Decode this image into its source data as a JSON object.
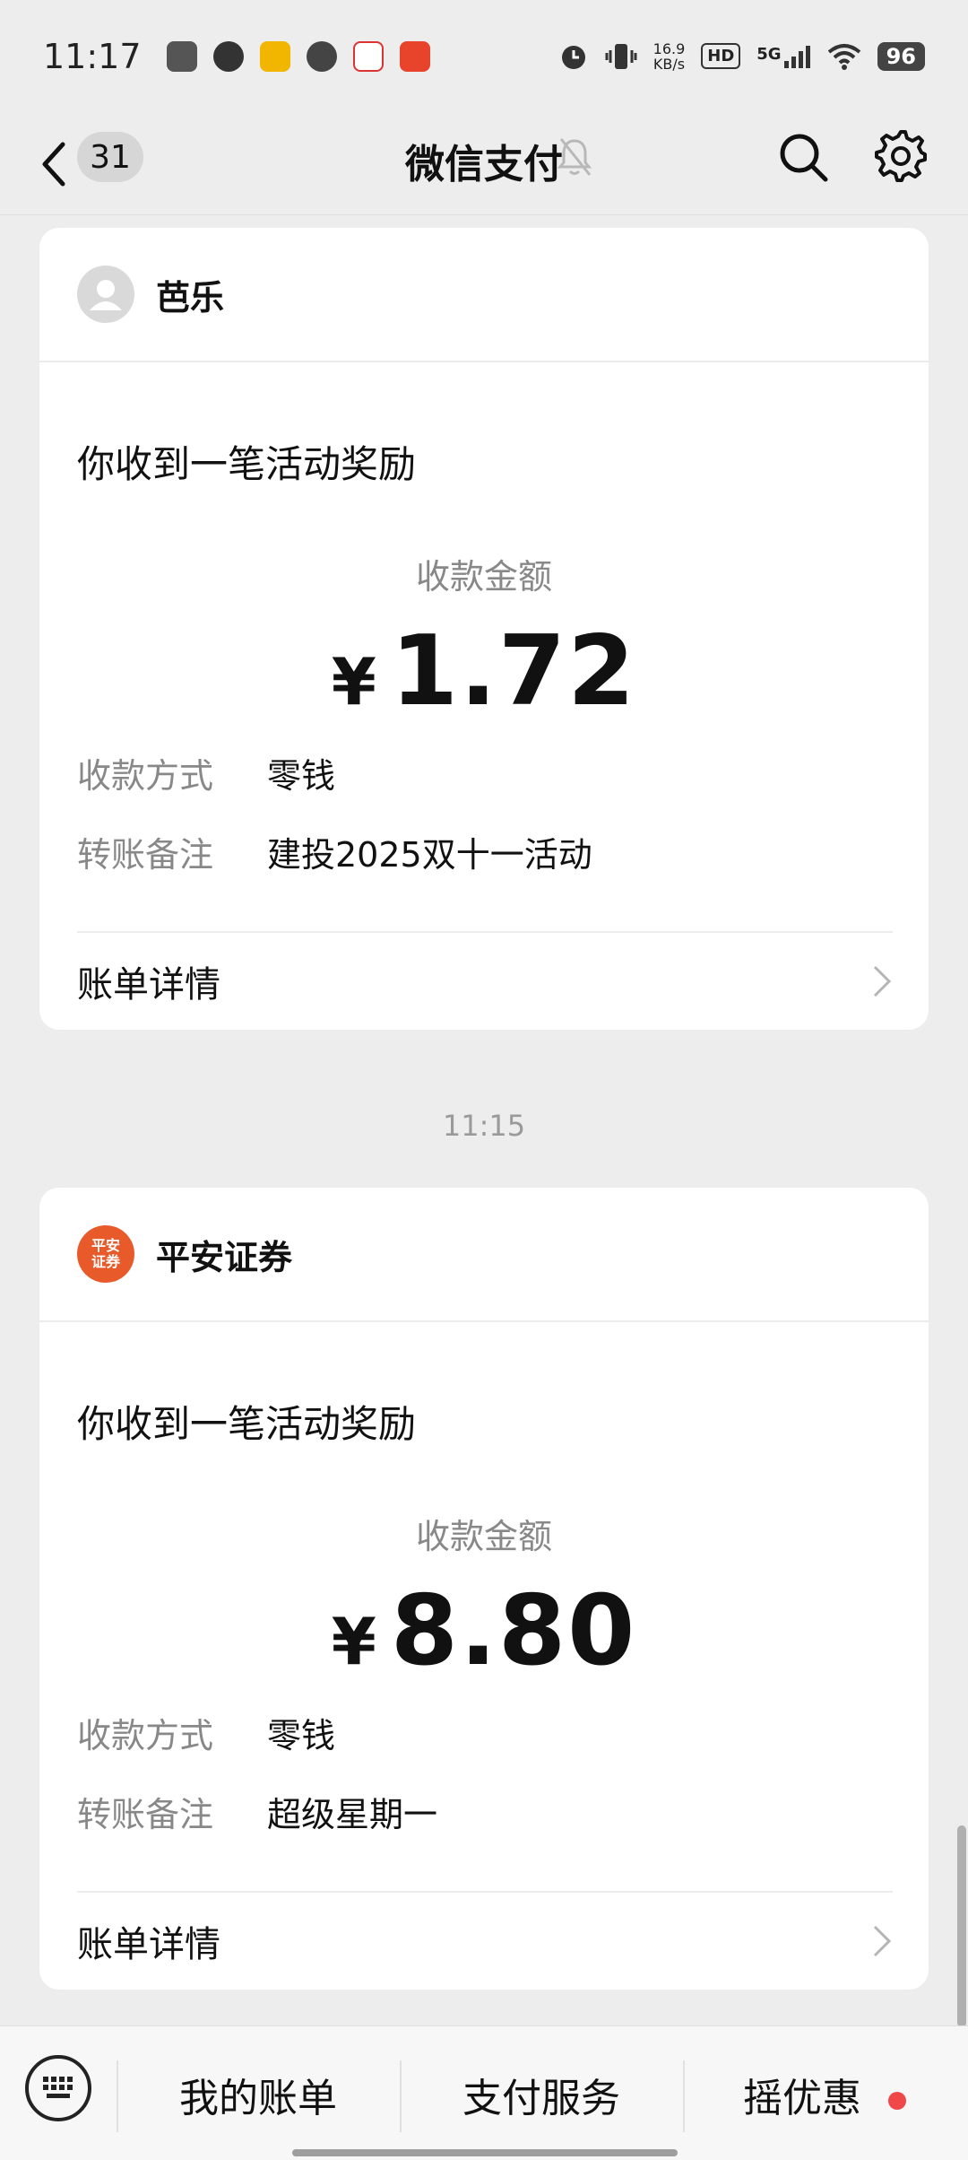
{
  "status_bar": {
    "time": "11:17",
    "net_speed_value": "16.9",
    "net_speed_unit": "KB/s",
    "hd": "HD",
    "signal": "5G",
    "battery": "96"
  },
  "header": {
    "unread_count": "31",
    "title": "微信支付"
  },
  "messages": [
    {
      "sender": "芭乐",
      "headline": "你收到一笔活动奖励",
      "amount_label": "收款金额",
      "currency": "¥",
      "amount": "1.72",
      "method_key": "收款方式",
      "method_val": "零钱",
      "note_key": "转账备注",
      "note_val": "建投2025双十一活动",
      "detail_label": "账单详情"
    },
    {
      "timestamp": "11:15",
      "sender": "平安证券",
      "sender_logo_line1": "平安",
      "sender_logo_line2": "证券",
      "headline": "你收到一笔活动奖励",
      "amount_label": "收款金额",
      "currency": "¥",
      "amount": "8.80",
      "method_key": "收款方式",
      "method_val": "零钱",
      "note_key": "转账备注",
      "note_val": "超级星期一",
      "detail_label": "账单详情"
    }
  ],
  "bottom_menu": {
    "items": [
      "我的账单",
      "支付服务",
      "摇优惠"
    ]
  },
  "colors": {
    "background": "#ededed",
    "card": "#ffffff",
    "logo_orange": "#e85a2a",
    "red_dot": "#f04848"
  }
}
